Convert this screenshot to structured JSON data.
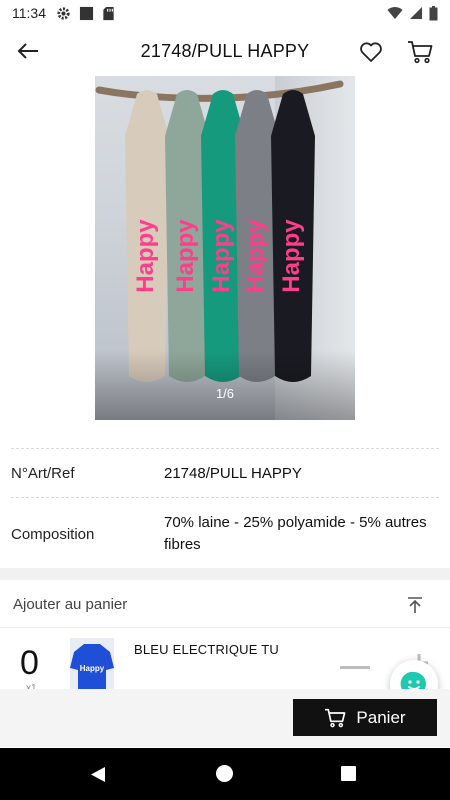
{
  "status_bar": {
    "time": "11:34",
    "left_icons": [
      "gear-icon",
      "square-icon",
      "sd-card-icon"
    ],
    "right_icons": [
      "wifi-icon",
      "signal-icon",
      "battery-icon"
    ]
  },
  "header": {
    "title": "21748/PULL HAPPY",
    "back_icon": "arrow-left-icon",
    "favorite_icon": "heart-icon",
    "cart_icon": "cart-icon"
  },
  "gallery": {
    "page_indicator": "1/6",
    "sweater_text": "Happy",
    "sweater_colors": [
      "#d7cbbb",
      "#8fa79a",
      "#169a7e",
      "#7c7f86",
      "#1a1b22"
    ],
    "print_color": "#ff3d8b"
  },
  "details": {
    "rows": [
      {
        "label": "N°Art/Ref",
        "value": "21748/PULL HAPPY"
      },
      {
        "label": "Composition",
        "value": "70% laine - 25% polyamide - 5% autres fibres"
      }
    ]
  },
  "add_to_cart": {
    "label": "Ajouter au panier",
    "collapse_icon": "arrow-up-to-top-icon",
    "variant": {
      "quantity": "0",
      "sub": "x1",
      "name": "BLEU ELECTRIQUE TU",
      "thumb_color": "#1f4fd6",
      "thumb_text": "Happy"
    }
  },
  "bottom_bar": {
    "cart_button_label": "Panier"
  },
  "colors": {
    "accent_dark": "#111111",
    "chat_fab": "#1fc8b0",
    "section_gap": "#f1f1f1"
  }
}
